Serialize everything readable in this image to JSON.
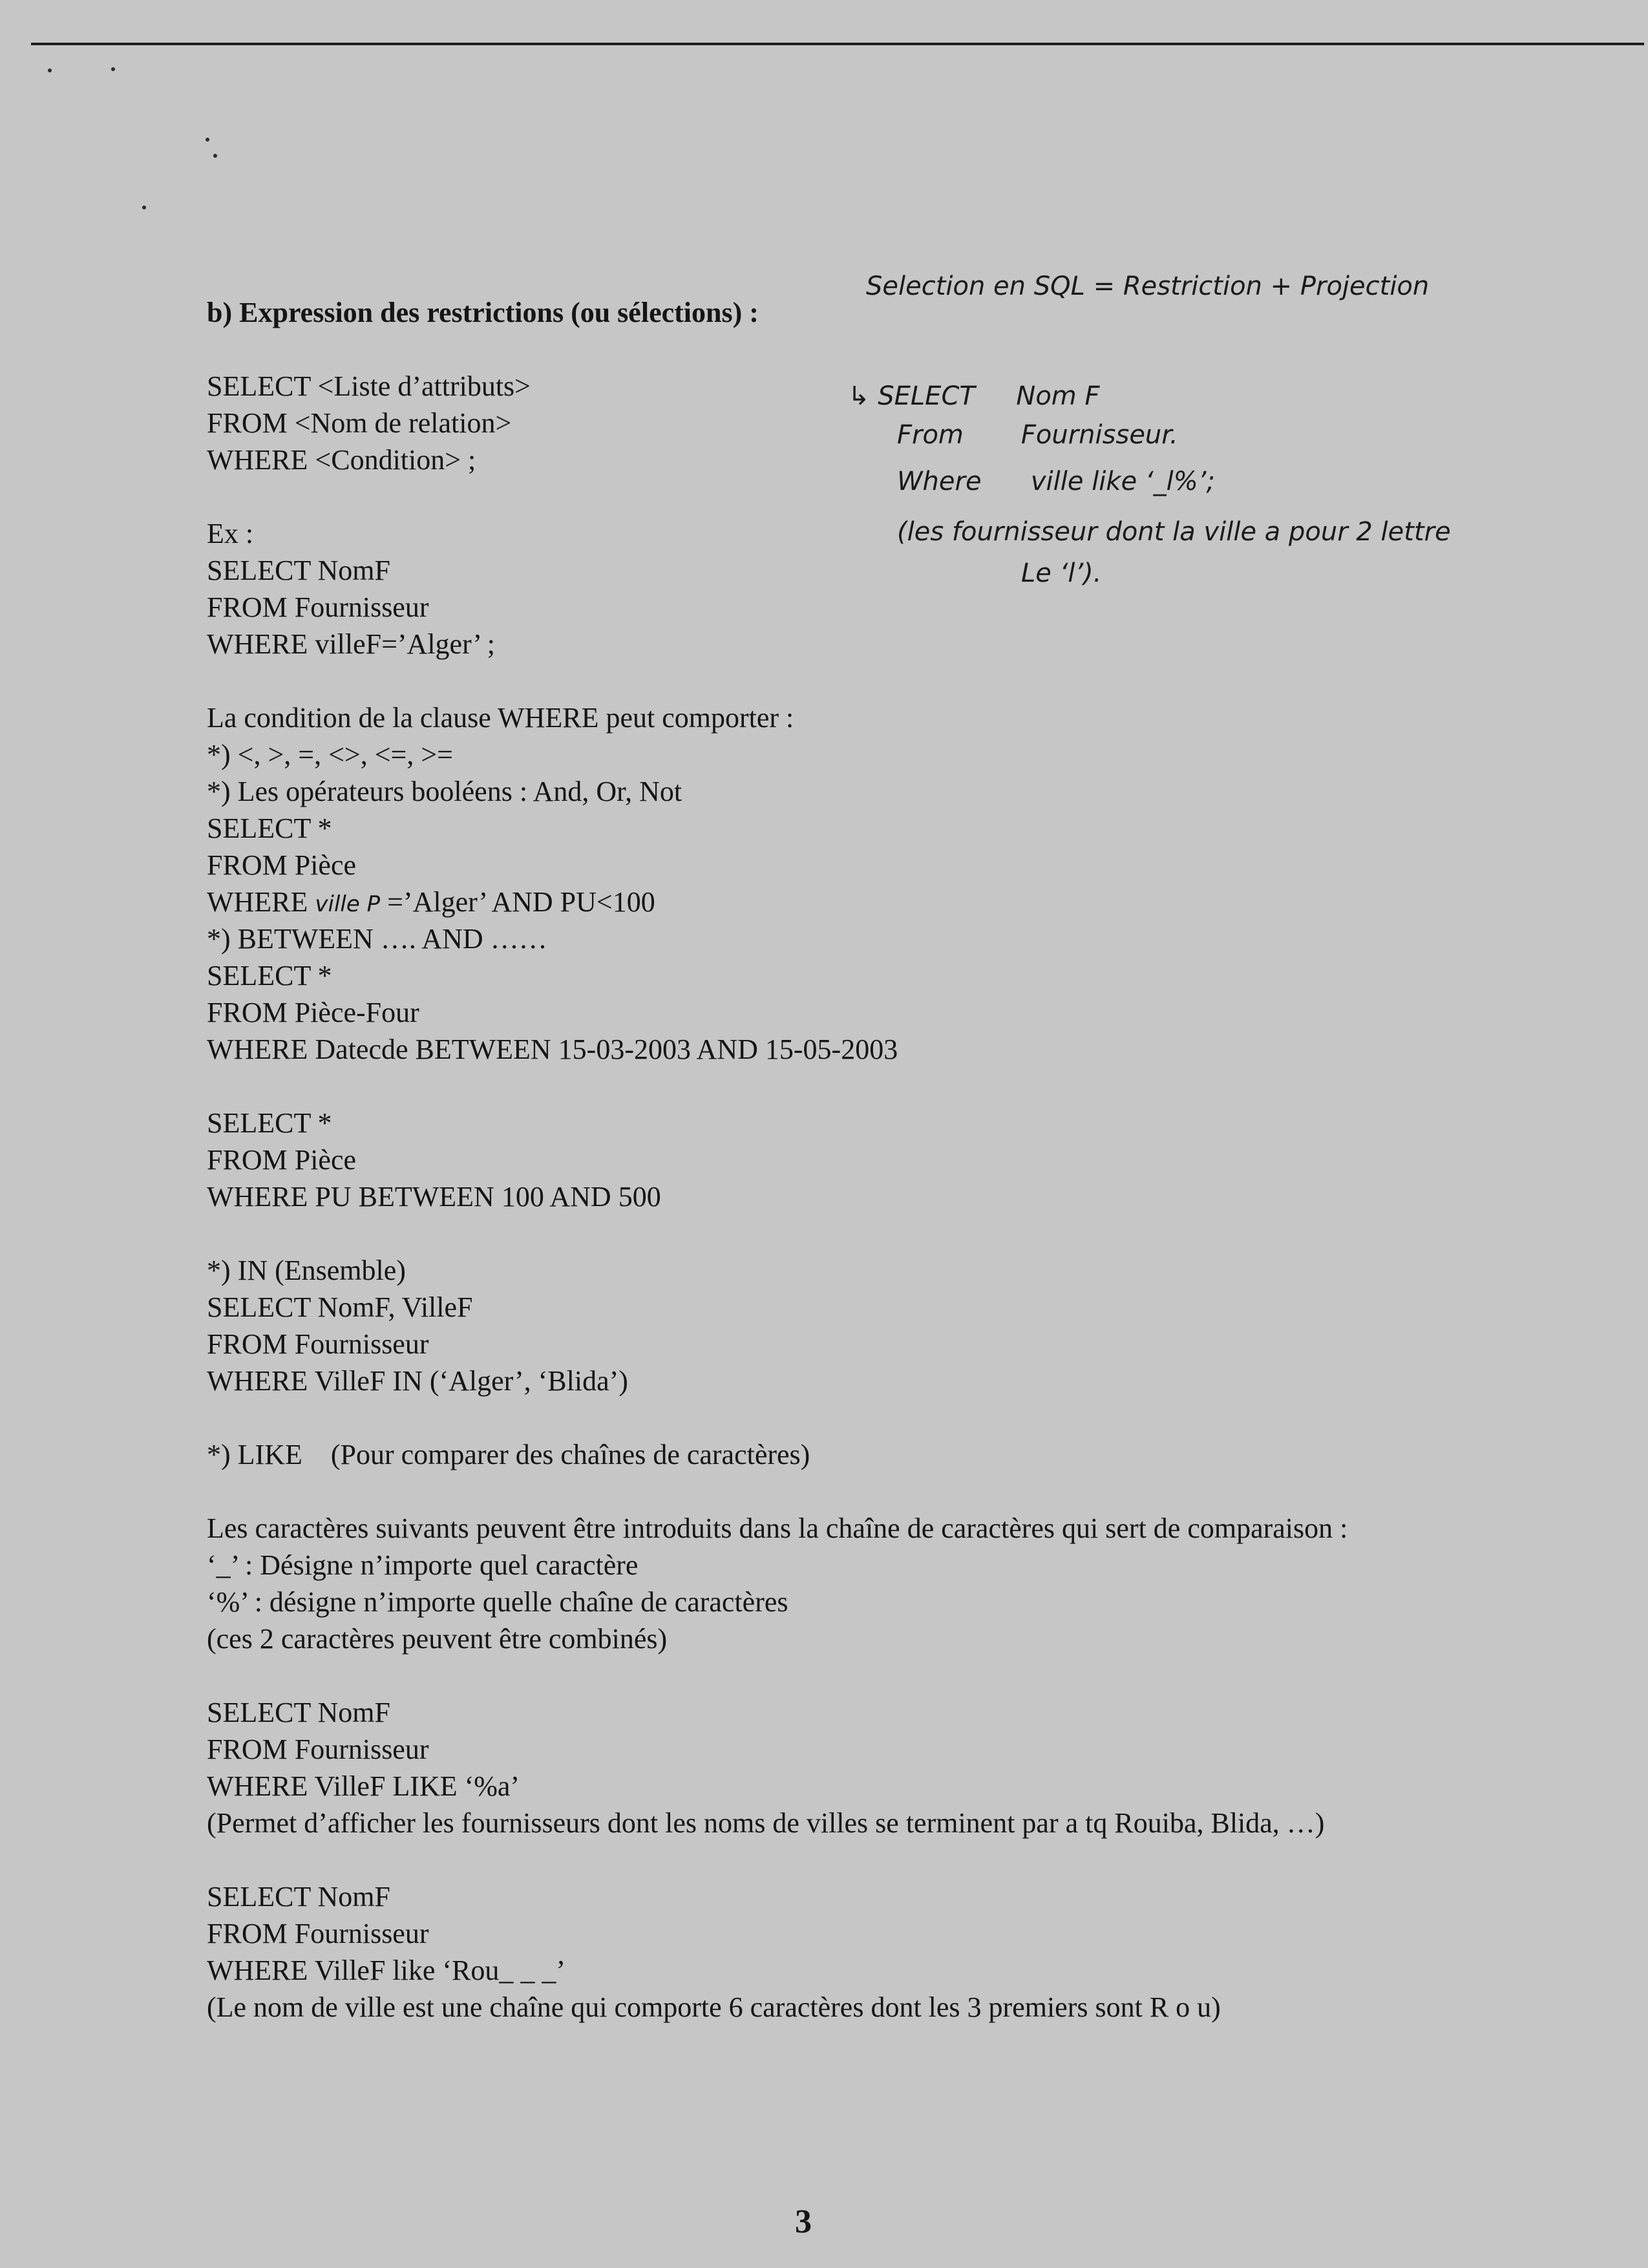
{
  "heading": "b) Expression des restrictions (ou sélections) :",
  "syntax": [
    "SELECT <Liste d’attributs>",
    "FROM <Nom de relation>",
    "WHERE <Condition> ;"
  ],
  "example": [
    "Ex :",
    "SELECT NomF",
    "FROM Fournisseur",
    "WHERE villeF=’Alger’ ;"
  ],
  "where_intro": "La condition de la clause WHERE peut comporter :",
  "ops_comparison": "*) <, >, =, <>, <=, >=",
  "ops_boolean": "*) Les opérateurs booléens : And, Or, Not",
  "bool_example": {
    "select": "SELECT *",
    "from": "FROM Pièce",
    "where_before": "WHERE ",
    "where_handwritten": "ville P",
    "where_after": " =’Alger’ AND PU<100"
  },
  "between_title": "*) BETWEEN …. AND ……",
  "between_example1": [
    "SELECT *",
    "FROM Pièce-Four",
    "WHERE Datecde BETWEEN 15-03-2003 AND 15-05-2003"
  ],
  "between_example2": [
    "SELECT *",
    "FROM Pièce",
    "WHERE PU BETWEEN 100 AND 500"
  ],
  "in_block": [
    "*) IN (Ensemble)",
    "SELECT NomF, VilleF",
    "FROM Fournisseur",
    "WHERE VilleF IN (‘Alger’, ‘Blida’)"
  ],
  "like_title": "*) LIKE    (Pour comparer des chaînes de caractères)",
  "like_intro": "Les caractères suivants peuvent être introduits dans la chaîne de caractères qui sert de comparaison :",
  "wildcards": [
    "‘_’ : Désigne n’importe quel caractère",
    "‘%’ : désigne n’importe quelle chaîne de caractères",
    "(ces 2 caractères peuvent être combinés)"
  ],
  "like_example1": [
    "SELECT NomF",
    "FROM Fournisseur",
    "WHERE VilleF LIKE ‘%a’"
  ],
  "like_example1_note": "(Permet d’afficher les fournisseurs dont les noms de villes se terminent par a tq Rouiba, Blida, …)",
  "like_example2": [
    "SELECT NomF",
    "FROM Fournisseur",
    "WHERE VilleF like ‘Rou_ _ _’"
  ],
  "like_example2_note": "(Le nom de ville est une chaîne qui comporte 6 caractères dont les 3 premiers sont R o u)",
  "handwritten_notes": {
    "title": "Selection en SQL = Restriction + Projection",
    "lines": [
      "↳ SELECT     Nom F",
      "From       Fournisseur.",
      "Where      ville like ‘_l%’;",
      "(les fournisseur dont la ville a pour 2 lettre",
      "Le ‘l’)."
    ]
  },
  "page_number": "3"
}
